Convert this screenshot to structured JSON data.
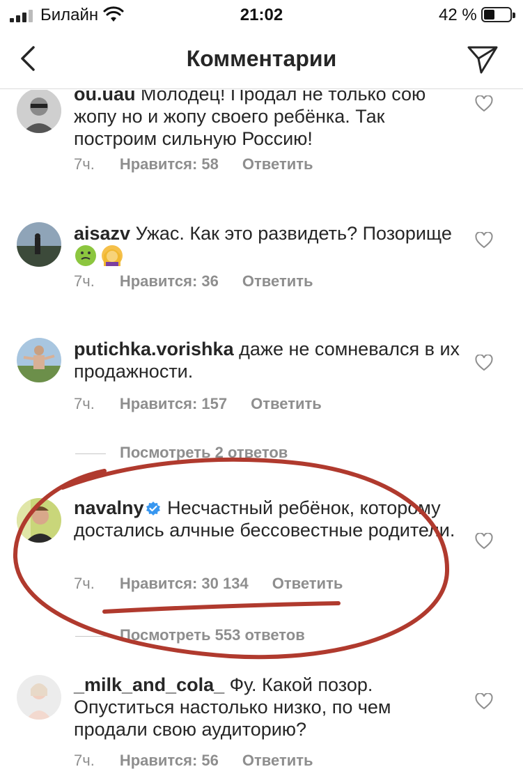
{
  "status_bar": {
    "carrier": "Билайн",
    "time": "21:02",
    "battery_percent": "42 %",
    "battery_level": 0.42
  },
  "nav": {
    "title": "Комментарии",
    "back_icon": "chevron-left-icon",
    "send_icon": "paper-plane-icon"
  },
  "comments": [
    {
      "username": "ou.uau",
      "text": "Молодец! Продал не только сою жопу но и жопу своего ребёнка. Так построим сильную Россию!",
      "time": "7ч.",
      "likes": "Нравится: 58",
      "reply": "Ответить"
    },
    {
      "username": "aisazv",
      "text": "Ужас. Как это развидеть? Позорище",
      "emoji": [
        "nauseated-face",
        "woman-facepalming"
      ],
      "time": "7ч.",
      "likes": "Нравится: 36",
      "reply": "Ответить"
    },
    {
      "username": "putichka.vorishka",
      "text": "даже не сомневался в их продажности.",
      "time": "7ч.",
      "likes": "Нравится: 157",
      "reply": "Ответить",
      "view_replies": "Посмотреть 2 ответов"
    },
    {
      "username": "navalny",
      "verified": true,
      "text": "Несчастный ребёнок, которому достались алчные бессовестные родители.",
      "time": "7ч.",
      "likes": "Нравится: 30 134",
      "reply": "Ответить",
      "view_replies": "Посмотреть 553 ответов"
    },
    {
      "username": "_milk_and_cola_",
      "text": "Фу. Какой позор. Опуститься настолько низко, по чем продали свою аудиторию?",
      "time": "7ч.",
      "likes": "Нравится: 56",
      "reply": "Ответить"
    }
  ],
  "colors": {
    "text": "#262626",
    "meta": "#8e8e8e",
    "verified": "#3897f0",
    "annotation": "#b03a2e"
  }
}
